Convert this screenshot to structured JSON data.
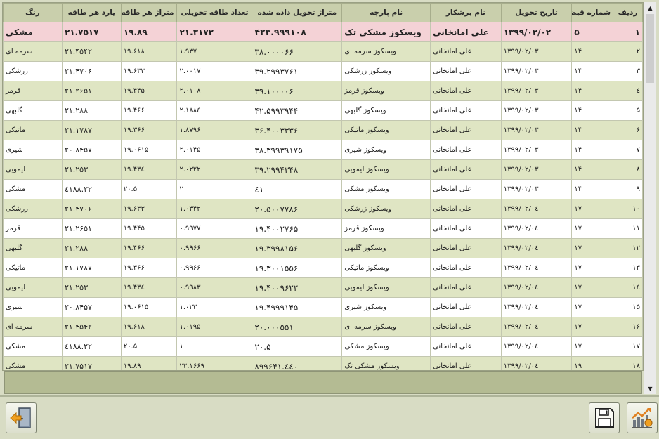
{
  "columns": {
    "row": "ردیف",
    "receipt": "شماره قبض",
    "date": "تاریخ تحویل",
    "person": "نام برشکار",
    "fabric": "نام پارچه",
    "meters": "متراژ تحویل داده شده",
    "count": "تعداد طاقه تحویلی",
    "meters_per_bolt": "متراژ هر طاقه",
    "yards_per_bolt": "یارد هر طاقه",
    "color": "رنگ"
  },
  "rows": [
    {
      "row": "۱",
      "receipt": "۵",
      "date": "۱۳۹۹/۰۲/۰۲",
      "person": "علی امانخانی",
      "fabric": "ویسکوز مشکی تک",
      "meters": "۴۲۳.۹۹۹۱۰۸",
      "count": "۲۱.۳۱۷۲",
      "mpb": "۱۹.۸۹",
      "ypb": "۲۱.۷۵۱۷",
      "color": "مشکی",
      "selected": true
    },
    {
      "row": "۲",
      "receipt": "۱۴",
      "date": "۱۳۹۹/۰۲/۰۳",
      "person": "علی امانخانی",
      "fabric": "ویسکوز سرمه ای",
      "meters": "۳۸.۰۰۰۰۶۶",
      "count": "۱.۹۳۷",
      "mpb": "۱۹.۶۱۸",
      "ypb": "۲۱.۴۵۴۲",
      "color": "سرمه ای"
    },
    {
      "row": "۳",
      "receipt": "۱۴",
      "date": "۱۳۹۹/۰۲/۰۳",
      "person": "علی امانخانی",
      "fabric": "ویسکوز زرشکی",
      "meters": "۳۹.۲۹۹۳۷۶۱",
      "count": "۲.۰۰۱۷",
      "mpb": "۱۹.۶۳۳",
      "ypb": "۲۱.۴۷۰۶",
      "color": "زرشکی"
    },
    {
      "row": "٤",
      "receipt": "۱۴",
      "date": "۱۳۹۹/۰۲/۰۳",
      "person": "علی امانخانی",
      "fabric": "ویسکوز قرمز",
      "meters": "۳۹.۱۰۰۰۰۶",
      "count": "۲.۰۱۰۸",
      "mpb": "۱۹.۴۴۵",
      "ypb": "۲۱.۲۶۵۱",
      "color": "قرمز"
    },
    {
      "row": "۵",
      "receipt": "۱۴",
      "date": "۱۳۹۹/۰۲/۰۳",
      "person": "علی امانخانی",
      "fabric": "ویسکوز گلبهی",
      "meters": "۴۲.۵۹۹۳۹۴۴",
      "count": "۲.۱۸۸٤",
      "mpb": "۱۹.۴۶۶",
      "ypb": "۲۱.۲۸۸",
      "color": "گلبهی"
    },
    {
      "row": "۶",
      "receipt": "۱۴",
      "date": "۱۳۹۹/۰۲/۰۳",
      "person": "علی امانخانی",
      "fabric": "ویسکوز ماتیکی",
      "meters": "۳۶.۴۰۰۳۳۳۶",
      "count": "۱.۸۷۹۶",
      "mpb": "۱۹.۳۶۶",
      "ypb": "۲۱.۱۷۸۷",
      "color": "ماتیکی"
    },
    {
      "row": "۷",
      "receipt": "۱۴",
      "date": "۱۳۹۹/۰۲/۰۳",
      "person": "علی امانخانی",
      "fabric": "ویسکوز شیری",
      "meters": "۳۸.۳۹۹۳۹۱۷۵",
      "count": "۲.۰۱۴۵",
      "mpb": "۱۹.۰۶۱۵",
      "ypb": "۲۰.۸۴۵۷",
      "color": "شیری"
    },
    {
      "row": "۸",
      "receipt": "۱۴",
      "date": "۱۳۹۹/۰۲/۰۳",
      "person": "علی امانخانی",
      "fabric": "ویسکوز لیمویی",
      "meters": "۳۹.۲۹۹۴۳۴۸",
      "count": "۲.۰۲۲۲",
      "mpb": "۱۹.۴۳٤",
      "ypb": "۲۱.۲۵۳",
      "color": "لیمویی"
    },
    {
      "row": "۹",
      "receipt": "۱۴",
      "date": "۱۳۹۹/۰۲/۰۳",
      "person": "علی امانخانی",
      "fabric": "ویسکوز مشکی",
      "meters": "٤١",
      "count": "۲",
      "mpb": "۲۰.۵",
      "ypb": "۲۲.٤۱۸۸",
      "color": "مشکی"
    },
    {
      "row": "۱۰",
      "receipt": "۱۷",
      "date": "۱۳۹۹/۰۲/۰٤",
      "person": "علی امانخانی",
      "fabric": "ویسکوز زرشکی",
      "meters": "۲۰.۵۰۰۷۷۸۶",
      "count": "۱.۰۴۴۲",
      "mpb": "۱۹.۶۳۳",
      "ypb": "۲۱.۴۷۰۶",
      "color": "زرشکی"
    },
    {
      "row": "۱۱",
      "receipt": "۱۷",
      "date": "۱۳۹۹/۰۲/۰٤",
      "person": "علی امانخانی",
      "fabric": "ویسکوز قرمز",
      "meters": "۱۹.۴۰۰۲۷۶۵",
      "count": "۰.۹۹۷۷",
      "mpb": "۱۹.۴۴۵",
      "ypb": "۲۱.۲۶۵۱",
      "color": "قرمز"
    },
    {
      "row": "۱۲",
      "receipt": "۱۷",
      "date": "۱۳۹۹/۰۲/۰٤",
      "person": "علی امانخانی",
      "fabric": "ویسکوز گلبهی",
      "meters": "۱۹.۳۹۹۸۱۵۶",
      "count": "۰.۹۹۶۶",
      "mpb": "۱۹.۴۶۶",
      "ypb": "۲۱.۲۸۸",
      "color": "گلبهی"
    },
    {
      "row": "۱۳",
      "receipt": "۱۷",
      "date": "۱۳۹۹/۰۲/۰٤",
      "person": "علی امانخانی",
      "fabric": "ویسکوز ماتیکی",
      "meters": "۱۹.۳۰۰۱۵۵۶",
      "count": "۰.۹۹۶۶",
      "mpb": "۱۹.۳۶۶",
      "ypb": "۲۱.۱۷۸۷",
      "color": "ماتیکی"
    },
    {
      "row": "۱٤",
      "receipt": "۱۷",
      "date": "۱۳۹۹/۰۲/۰٤",
      "person": "علی امانخانی",
      "fabric": "ویسکوز لیمویی",
      "meters": "۱۹.۴۰۰۹۶۲۲",
      "count": "۰.۹۹۸۳",
      "mpb": "۱۹.۴۳٤",
      "ypb": "۲۱.۲۵۳",
      "color": "لیمویی"
    },
    {
      "row": "۱۵",
      "receipt": "۱۷",
      "date": "۱۳۹۹/۰۲/۰٤",
      "person": "علی امانخانی",
      "fabric": "ویسکوز شیری",
      "meters": "۱۹.۴۹۹۹۱۴۵",
      "count": "۱.۰۲۳",
      "mpb": "۱۹.۰۶۱۵",
      "ypb": "۲۰.۸۴۵۷",
      "color": "شیری"
    },
    {
      "row": "۱۶",
      "receipt": "۱۷",
      "date": "۱۳۹۹/۰۲/۰٤",
      "person": "علی امانخانی",
      "fabric": "ویسکوز سرمه ای",
      "meters": "۲۰.۰۰۰۵۵۱",
      "count": "۱.۰۱۹۵",
      "mpb": "۱۹.۶۱۸",
      "ypb": "۲۱.۴۵۴۲",
      "color": "سرمه ای"
    },
    {
      "row": "۱۷",
      "receipt": "۱۷",
      "date": "۱۳۹۹/۰۲/۰٤",
      "person": "علی امانخانی",
      "fabric": "ویسکوز مشکی",
      "meters": "۲۰.۵",
      "count": "۱",
      "mpb": "۲۰.۵",
      "ypb": "۲۲.٤۱۸۸",
      "color": "مشکی"
    },
    {
      "row": "۱۸",
      "receipt": "۱۹",
      "date": "۱۳۹۹/۰۲/۰٤",
      "person": "علی امانخانی",
      "fabric": "ویسکوز مشکی تک",
      "meters": "٤٤٠.۸۹۹۶۴۱",
      "count": "۲۲.۱۶۶۹",
      "mpb": "۱۹.۸۹",
      "ypb": "۲۱.۷۵۱۷",
      "color": "مشکی"
    }
  ],
  "icons": {
    "exit": "exit-door-icon",
    "save": "floppy-disk-icon",
    "report": "bar-chart-report-icon",
    "scroll_up": "triangle-up-icon",
    "scroll_down": "triangle-down-icon"
  },
  "colors": {
    "header_bg": "#c9cfac",
    "row_alt": "#dfe5c3",
    "row_selected": "#f4d2d6",
    "footer_bg": "#b4bb93",
    "exit_accent": "#f0a020",
    "report_accent": "#e08020"
  }
}
